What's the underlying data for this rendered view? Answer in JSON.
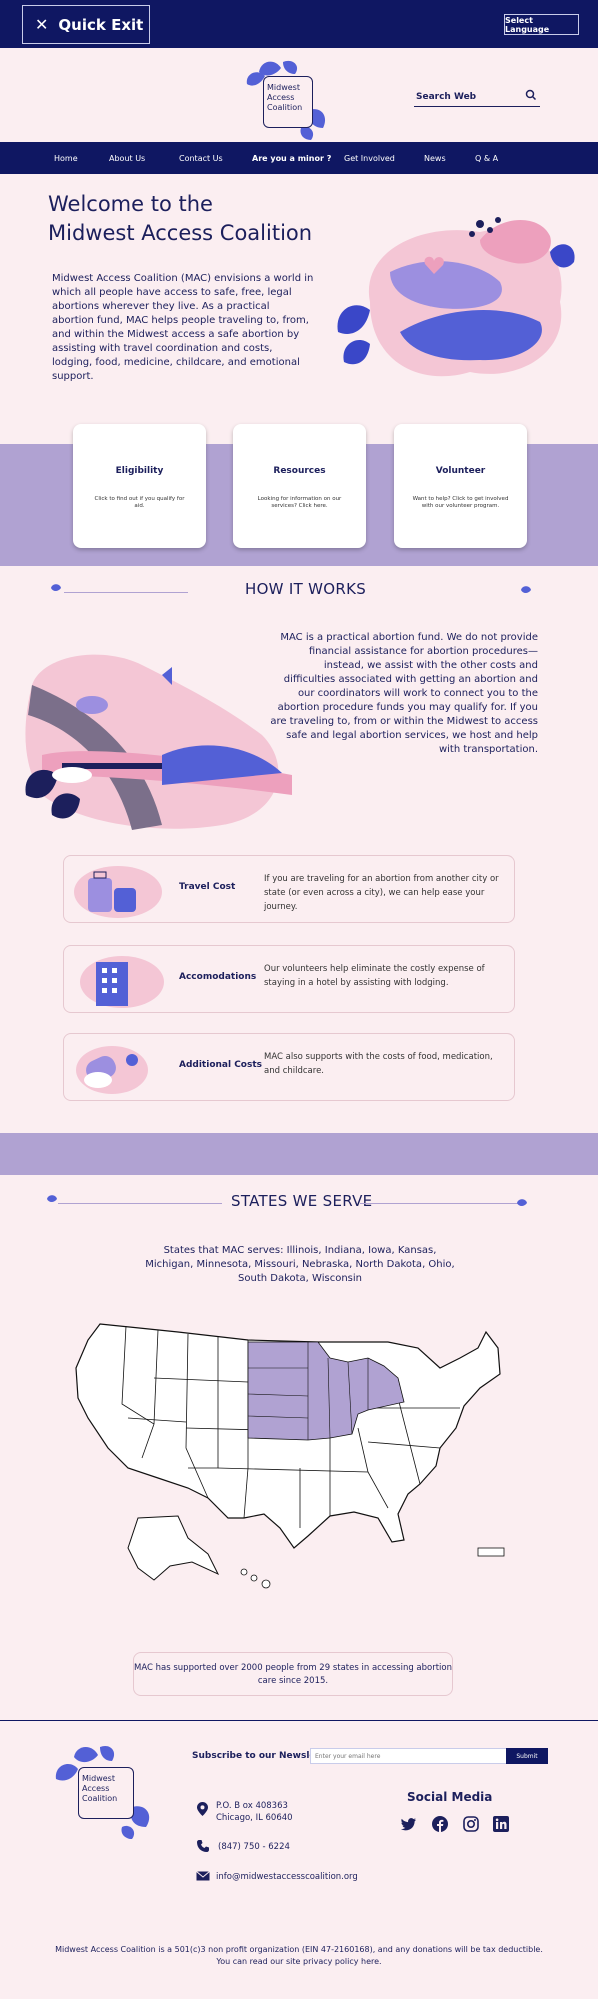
{
  "topbar": {
    "quick_exit": "Quick Exit",
    "language": "Select Language"
  },
  "logo": {
    "line1": "Midwest",
    "line2": "Access",
    "line3": "Coalition"
  },
  "search": {
    "label": "Search Web"
  },
  "nav": [
    "Home",
    "About Us",
    "Contact Us",
    "Are you a minor ?",
    "Get Involved",
    "News",
    "Q & A"
  ],
  "hero": {
    "title_line1": "Welcome to the",
    "title_line2": "Midwest Access Coalition",
    "text": "Midwest Access Coalition (MAC) envisions a world in which all people have access to safe, free, legal abortions wherever they live. As a practical abortion fund, MAC helps people traveling to, from, and within the Midwest access a safe abortion by assisting with travel coordination and costs, lodging, food, medicine, childcare, and emotional support."
  },
  "cards": [
    {
      "title": "Eligibility",
      "text": "Click to find out if you qualify for aid."
    },
    {
      "title": "Resources",
      "text": "Looking for information on our services? Click here."
    },
    {
      "title": "Volunteer",
      "text": "Want to help? Click to get involved with our volunteer program."
    }
  ],
  "how": {
    "title": "HOW IT WORKS",
    "text": "MAC is a practical abortion fund. We do not provide financial assistance for abortion procedures—instead, we assist with the other costs and difficulties associated with getting an abortion and our coordinators will work to connect you to the abortion procedure funds you may qualify for. If you are traveling to, from or within the Midwest to access safe and legal abortion services, we host and help with transportation."
  },
  "services": [
    {
      "title": "Travel Cost",
      "text": "If you are traveling for an abortion from another city or state (or even across a city), we can help ease your journey."
    },
    {
      "title": "Accomodations",
      "text": "Our volunteers help eliminate the costly expense of staying in a hotel by assisting with lodging."
    },
    {
      "title": "Additional Costs",
      "text": "MAC also supports with the costs of food, medication, and childcare."
    }
  ],
  "states": {
    "title": "STATES WE SERVE",
    "text": "States that MAC serves: Illinois, Indiana, Iowa, Kansas, Michigan, Minnesota, Missouri, Nebraska, North Dakota, Ohio, South Dakota, Wisconsin",
    "stat": "MAC has supported over 2000 people from 29 states in accessing abortion care since 2015."
  },
  "footer": {
    "newsletter": "Subscribe to our Newsletter",
    "email_placeholder": "Enter your email here",
    "submit": "Submit",
    "address_line1": "P.O. B ox 408363",
    "address_line2": "Chicago, IL 60640",
    "phone": "(847) 750 - 6224",
    "email": "info@midwestaccesscoalition.org",
    "social_title": "Social Media",
    "disclaimer_line1": "Midwest Access Coalition is a 501(c)3 non profit organization (EIN 47-2160168), and any donations will be tax deductible.",
    "disclaimer_line2": "You can read our site privacy policy here."
  },
  "colors": {
    "navy": "#0f1762",
    "lavender": "#b0a2d2",
    "blush": "#fbeef1",
    "periwinkle": "#5360d6",
    "pink": "#eda0bd"
  },
  "icons": [
    "close-icon",
    "search-icon",
    "location-pin-icon",
    "phone-icon",
    "mail-icon",
    "twitter-icon",
    "facebook-icon",
    "instagram-icon",
    "linkedin-icon"
  ]
}
